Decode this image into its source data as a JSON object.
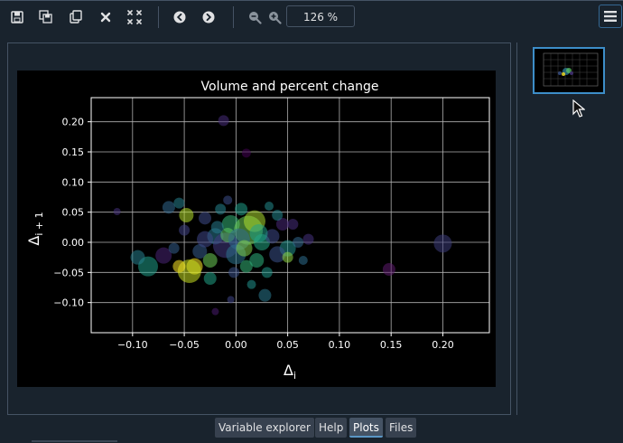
{
  "toolbar": {
    "icons": [
      "save-icon",
      "save-all-icon",
      "copy-icon",
      "close-icon",
      "close-all-icon",
      "previous-icon",
      "next-icon",
      "zoom-out-icon",
      "zoom-in-icon"
    ],
    "zoom_value": "126 %",
    "menu_icon": "hamburger-menu-icon"
  },
  "tabs": [
    {
      "label": "Variable explorer",
      "active": false
    },
    {
      "label": "Help",
      "active": false
    },
    {
      "label": "Plots",
      "active": true
    },
    {
      "label": "Files",
      "active": false
    }
  ],
  "colors": {
    "background": "#19232d",
    "border": "#455364",
    "accent": "#3d8ec9",
    "figure_background": "#000000"
  },
  "chart_data": {
    "type": "scatter",
    "title": "Volume and percent change",
    "xlabel": "Δ_i",
    "ylabel": "Δ_i+1",
    "xlim": [
      -0.14,
      0.245
    ],
    "ylim": [
      -0.15,
      0.24
    ],
    "xticks": [
      "−0.10",
      "−0.05",
      "0.00",
      "0.05",
      "0.10",
      "0.15",
      "0.20"
    ],
    "xtick_values": [
      -0.1,
      -0.05,
      0.0,
      0.05,
      0.1,
      0.15,
      0.2
    ],
    "yticks": [
      "0.20",
      "0.15",
      "0.10",
      "0.05",
      "0.00",
      "−0.05",
      "−0.10"
    ],
    "ytick_values": [
      0.2,
      0.15,
      0.1,
      0.05,
      0.0,
      -0.05,
      -0.1
    ],
    "grid": true,
    "points": [
      {
        "x": -0.012,
        "y": 0.202,
        "s": 6,
        "c": "#472c7a"
      },
      {
        "x": 0.01,
        "y": 0.148,
        "s": 5,
        "c": "#440154"
      },
      {
        "x": -0.115,
        "y": 0.051,
        "s": 4,
        "c": "#46317e"
      },
      {
        "x": -0.065,
        "y": 0.058,
        "s": 7,
        "c": "#31688e"
      },
      {
        "x": -0.055,
        "y": 0.065,
        "s": 6,
        "c": "#26828e"
      },
      {
        "x": -0.048,
        "y": 0.045,
        "s": 8,
        "c": "#b5de2b"
      },
      {
        "x": -0.03,
        "y": 0.04,
        "s": 7,
        "c": "#3e4a89"
      },
      {
        "x": -0.02,
        "y": 0.01,
        "s": 9,
        "c": "#2a788e"
      },
      {
        "x": -0.005,
        "y": 0.03,
        "s": 10,
        "c": "#35b779"
      },
      {
        "x": 0.005,
        "y": 0.055,
        "s": 7,
        "c": "#1f9e89"
      },
      {
        "x": 0.012,
        "y": 0.02,
        "s": 16,
        "c": "#6ece58"
      },
      {
        "x": 0.018,
        "y": 0.035,
        "s": 12,
        "c": "#addc30"
      },
      {
        "x": 0.025,
        "y": 0.0,
        "s": 9,
        "c": "#22a884"
      },
      {
        "x": 0.035,
        "y": 0.01,
        "s": 8,
        "c": "#3e4989"
      },
      {
        "x": 0.045,
        "y": 0.03,
        "s": 7,
        "c": "#482878"
      },
      {
        "x": 0.05,
        "y": -0.01,
        "s": 9,
        "c": "#21918c"
      },
      {
        "x": 0.06,
        "y": 0.0,
        "s": 6,
        "c": "#31688e"
      },
      {
        "x": -0.01,
        "y": -0.005,
        "s": 14,
        "c": "#443a83"
      },
      {
        "x": 0.0,
        "y": -0.02,
        "s": 11,
        "c": "#2c728e"
      },
      {
        "x": -0.025,
        "y": -0.03,
        "s": 8,
        "c": "#6ece58"
      },
      {
        "x": -0.04,
        "y": -0.04,
        "s": 9,
        "c": "#fde725"
      },
      {
        "x": -0.045,
        "y": -0.048,
        "s": 13,
        "c": "#c8e020"
      },
      {
        "x": -0.055,
        "y": -0.04,
        "s": 7,
        "c": "#fde725"
      },
      {
        "x": -0.085,
        "y": -0.04,
        "s": 11,
        "c": "#1f9e89"
      },
      {
        "x": -0.095,
        "y": -0.025,
        "s": 8,
        "c": "#277f8e"
      },
      {
        "x": -0.07,
        "y": -0.022,
        "s": 9,
        "c": "#482475"
      },
      {
        "x": -0.035,
        "y": -0.015,
        "s": 8,
        "c": "#365c8d"
      },
      {
        "x": 0.01,
        "y": -0.04,
        "s": 7,
        "c": "#35b779"
      },
      {
        "x": 0.02,
        "y": -0.03,
        "s": 8,
        "c": "#2db27d"
      },
      {
        "x": 0.03,
        "y": -0.05,
        "s": 6,
        "c": "#1f988b"
      },
      {
        "x": 0.04,
        "y": -0.02,
        "s": 9,
        "c": "#3b528b"
      },
      {
        "x": 0.05,
        "y": -0.025,
        "s": 6,
        "c": "#8fd744"
      },
      {
        "x": 0.07,
        "y": 0.005,
        "s": 6,
        "c": "#46327e"
      },
      {
        "x": 0.055,
        "y": 0.03,
        "s": 6,
        "c": "#472d7b"
      },
      {
        "x": -0.015,
        "y": 0.055,
        "s": 6,
        "c": "#25838e"
      },
      {
        "x": -0.025,
        "y": -0.06,
        "s": 7,
        "c": "#20a386"
      },
      {
        "x": -0.002,
        "y": -0.05,
        "s": 6,
        "c": "#3b528b"
      },
      {
        "x": 0.028,
        "y": -0.088,
        "s": 7,
        "c": "#2a788e"
      },
      {
        "x": 0.015,
        "y": -0.07,
        "s": 5,
        "c": "#21918c"
      },
      {
        "x": -0.02,
        "y": -0.115,
        "s": 4,
        "c": "#481b6d"
      },
      {
        "x": -0.005,
        "y": -0.095,
        "s": 4,
        "c": "#404688"
      },
      {
        "x": 0.148,
        "y": -0.045,
        "s": 7,
        "c": "#5c1a6e"
      },
      {
        "x": 0.2,
        "y": -0.002,
        "s": 10,
        "c": "#3d3c7a"
      },
      {
        "x": -0.008,
        "y": 0.012,
        "s": 8,
        "c": "#5ec962"
      },
      {
        "x": 0.003,
        "y": 0.005,
        "s": 12,
        "c": "#2f6c8e"
      },
      {
        "x": -0.03,
        "y": 0.005,
        "s": 9,
        "c": "#3f4788"
      },
      {
        "x": 0.022,
        "y": 0.015,
        "s": 10,
        "c": "#1fa088"
      },
      {
        "x": 0.008,
        "y": -0.01,
        "s": 9,
        "c": "#84d44b"
      },
      {
        "x": -0.018,
        "y": 0.025,
        "s": 7,
        "c": "#287c8e"
      },
      {
        "x": 0.04,
        "y": 0.045,
        "s": 6,
        "c": "#24868e"
      },
      {
        "x": -0.05,
        "y": 0.02,
        "s": 6,
        "c": "#414487"
      },
      {
        "x": -0.06,
        "y": -0.01,
        "s": 6,
        "c": "#355f8d"
      },
      {
        "x": 0.065,
        "y": -0.03,
        "s": 5,
        "c": "#2e6e8e"
      },
      {
        "x": 0.032,
        "y": 0.06,
        "s": 5,
        "c": "#228b8d"
      },
      {
        "x": -0.008,
        "y": 0.07,
        "s": 5,
        "c": "#3c4f8a"
      }
    ]
  }
}
